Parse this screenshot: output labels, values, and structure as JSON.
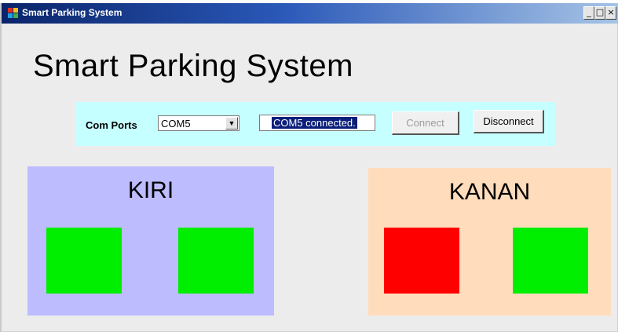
{
  "window": {
    "title": "Smart Parking System",
    "controls": {
      "minimize": "_",
      "maximize": "□",
      "close": "×"
    }
  },
  "heading": "Smart Parking System",
  "com": {
    "label": "Com Ports",
    "selected_port": "COM5",
    "status": "COM5 connected.",
    "connect_label": "Connect",
    "connect_enabled": false,
    "disconnect_label": "Disconnect"
  },
  "zones": {
    "left": {
      "title": "KIRI",
      "slots": [
        {
          "status": "free",
          "color": "#00ee00"
        },
        {
          "status": "free",
          "color": "#00ee00"
        }
      ]
    },
    "right": {
      "title": "KANAN",
      "slots": [
        {
          "status": "occupied",
          "color": "#ff0000"
        },
        {
          "status": "free",
          "color": "#00ee00"
        }
      ]
    }
  },
  "colors": {
    "panel_com": "#c6ffff",
    "zone_left": "#bdbcff",
    "zone_right": "#ffdcbc",
    "free": "#00ee00",
    "occupied": "#ff0000"
  }
}
